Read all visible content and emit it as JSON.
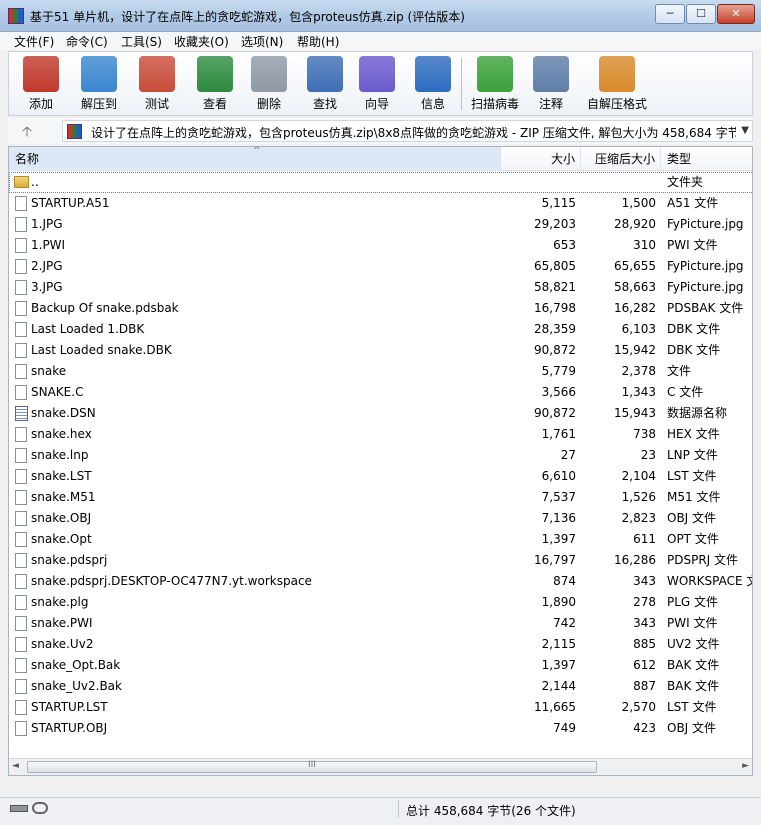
{
  "window": {
    "title": "基于51 单片机，设计了在点阵上的贪吃蛇游戏，包含proteus仿真.zip (评估版本)",
    "minimize_glyph": "─",
    "maximize_glyph": "☐",
    "close_glyph": "✕"
  },
  "menu": [
    "文件(F)",
    "命令(C)",
    "工具(S)",
    "收藏夹(O)",
    "选项(N)",
    "帮助(H)"
  ],
  "toolbar": [
    {
      "label": "添加",
      "icon": "archive-add-icon",
      "color": "#c0392b"
    },
    {
      "label": "解压到",
      "icon": "extract-folder-icon",
      "color": "#3a86d0"
    },
    {
      "label": "测试",
      "icon": "test-clipboard-icon",
      "color": "#c94c3a"
    },
    {
      "label": "查看",
      "icon": "view-book-icon",
      "color": "#2e8b3e"
    },
    {
      "label": "删除",
      "icon": "trash-icon",
      "color": "#8f9aa6"
    },
    {
      "label": "查找",
      "icon": "magnifier-icon",
      "color": "#3f6fb5"
    },
    {
      "label": "向导",
      "icon": "wizard-wand-icon",
      "color": "#6a5acd"
    },
    {
      "label": "信息",
      "icon": "info-icon",
      "color": "#2d6cc0"
    },
    {
      "label": "扫描病毒",
      "icon": "virus-scan-icon",
      "color": "#3aa23a"
    },
    {
      "label": "注释",
      "icon": "comment-icon",
      "color": "#5f7ea8"
    },
    {
      "label": "自解压格式",
      "icon": "sfx-box-icon",
      "color": "#d98b2b"
    }
  ],
  "pathbar": {
    "up_glyph": "🡡",
    "path": "设计了在点阵上的贪吃蛇游戏，包含proteus仿真.zip\\8x8点阵做的贪吃蛇游戏 - ZIP 压缩文件, 解包大小为 458,684 字节",
    "dropdown_glyph": "▼"
  },
  "columns": {
    "name": "名称",
    "size": "大小",
    "packed": "压缩后大小",
    "type": "类型",
    "sort_glyph": "^"
  },
  "rows": [
    {
      "name": "..",
      "size": "",
      "packed": "",
      "type": "文件夹",
      "kind": "folder"
    },
    {
      "name": "STARTUP.A51",
      "size": "5,115",
      "packed": "1,500",
      "type": "A51 文件",
      "kind": "file"
    },
    {
      "name": "1.JPG",
      "size": "29,203",
      "packed": "28,920",
      "type": "FyPicture.jpg",
      "kind": "file"
    },
    {
      "name": "1.PWI",
      "size": "653",
      "packed": "310",
      "type": "PWI 文件",
      "kind": "file"
    },
    {
      "name": "2.JPG",
      "size": "65,805",
      "packed": "65,655",
      "type": "FyPicture.jpg",
      "kind": "file"
    },
    {
      "name": "3.JPG",
      "size": "58,821",
      "packed": "58,663",
      "type": "FyPicture.jpg",
      "kind": "file"
    },
    {
      "name": "Backup Of snake.pdsbak",
      "size": "16,798",
      "packed": "16,282",
      "type": "PDSBAK 文件",
      "kind": "file"
    },
    {
      "name": "Last Loaded 1.DBK",
      "size": "28,359",
      "packed": "6,103",
      "type": "DBK 文件",
      "kind": "file"
    },
    {
      "name": "Last Loaded snake.DBK",
      "size": "90,872",
      "packed": "15,942",
      "type": "DBK 文件",
      "kind": "file"
    },
    {
      "name": "snake",
      "size": "5,779",
      "packed": "2,378",
      "type": "文件",
      "kind": "file"
    },
    {
      "name": "SNAKE.C",
      "size": "3,566",
      "packed": "1,343",
      "type": "C 文件",
      "kind": "file"
    },
    {
      "name": "snake.DSN",
      "size": "90,872",
      "packed": "15,943",
      "type": "数据源名称",
      "kind": "dsn"
    },
    {
      "name": "snake.hex",
      "size": "1,761",
      "packed": "738",
      "type": "HEX 文件",
      "kind": "file"
    },
    {
      "name": "snake.lnp",
      "size": "27",
      "packed": "23",
      "type": "LNP 文件",
      "kind": "file"
    },
    {
      "name": "snake.LST",
      "size": "6,610",
      "packed": "2,104",
      "type": "LST 文件",
      "kind": "file"
    },
    {
      "name": "snake.M51",
      "size": "7,537",
      "packed": "1,526",
      "type": "M51 文件",
      "kind": "file"
    },
    {
      "name": "snake.OBJ",
      "size": "7,136",
      "packed": "2,823",
      "type": "OBJ 文件",
      "kind": "file"
    },
    {
      "name": "snake.Opt",
      "size": "1,397",
      "packed": "611",
      "type": "OPT 文件",
      "kind": "file"
    },
    {
      "name": "snake.pdsprj",
      "size": "16,797",
      "packed": "16,286",
      "type": "PDSPRJ 文件",
      "kind": "file"
    },
    {
      "name": "snake.pdsprj.DESKTOP-OC477N7.yt.workspace",
      "size": "874",
      "packed": "343",
      "type": "WORKSPACE 文",
      "kind": "file"
    },
    {
      "name": "snake.plg",
      "size": "1,890",
      "packed": "278",
      "type": "PLG 文件",
      "kind": "file"
    },
    {
      "name": "snake.PWI",
      "size": "742",
      "packed": "343",
      "type": "PWI 文件",
      "kind": "file"
    },
    {
      "name": "snake.Uv2",
      "size": "2,115",
      "packed": "885",
      "type": "UV2 文件",
      "kind": "file"
    },
    {
      "name": "snake_Opt.Bak",
      "size": "1,397",
      "packed": "612",
      "type": "BAK 文件",
      "kind": "file"
    },
    {
      "name": "snake_Uv2.Bak",
      "size": "2,144",
      "packed": "887",
      "type": "BAK 文件",
      "kind": "file"
    },
    {
      "name": "STARTUP.LST",
      "size": "11,665",
      "packed": "2,570",
      "type": "LST 文件",
      "kind": "file"
    },
    {
      "name": "STARTUP.OBJ",
      "size": "749",
      "packed": "423",
      "type": "OBJ 文件",
      "kind": "file"
    }
  ],
  "hscroll": {
    "left_glyph": "◄",
    "right_glyph": "►",
    "grip_glyph": "III"
  },
  "status": {
    "summary": "总计 458,684 字节(26 个文件)"
  }
}
